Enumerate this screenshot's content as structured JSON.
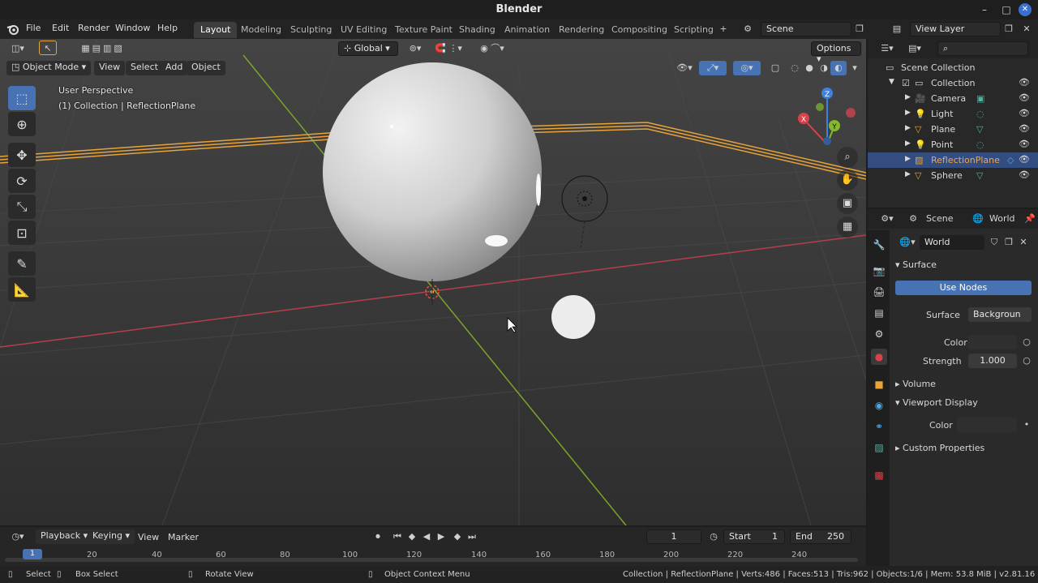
{
  "window": {
    "title": "Blender"
  },
  "menu": [
    "File",
    "Edit",
    "Render",
    "Window",
    "Help"
  ],
  "workspaces": [
    "Layout",
    "Modeling",
    "Sculpting",
    "UV Editing",
    "Texture Paint",
    "Shading",
    "Animation",
    "Rendering",
    "Compositing",
    "Scripting"
  ],
  "active_workspace": "Layout",
  "scene_field": "Scene",
  "view_layer_field": "View Layer",
  "viewport": {
    "mode": "Object Mode",
    "menus": [
      "View",
      "Select",
      "Add",
      "Object"
    ],
    "orientation": "Global",
    "options_label": "Options",
    "overlay_title": "User Perspective",
    "overlay_subtitle": "(1) Collection | ReflectionPlane",
    "gizmo_labels": {
      "x": "X",
      "y": "Y",
      "z": "Z"
    }
  },
  "outliner": {
    "root": "Scene Collection",
    "collection": "Collection",
    "items": [
      {
        "label": "Camera",
        "icon": "camera-icon"
      },
      {
        "label": "Light",
        "icon": "light-icon"
      },
      {
        "label": "Plane",
        "icon": "mesh-icon"
      },
      {
        "label": "Point",
        "icon": "light-icon"
      },
      {
        "label": "ReflectionPlane",
        "icon": "probe-icon",
        "selected": true
      },
      {
        "label": "Sphere",
        "icon": "mesh-icon"
      }
    ]
  },
  "properties": {
    "scene_label": "Scene",
    "world_label": "World",
    "world_name": "World",
    "surface_panel": "Surface",
    "use_nodes": "Use Nodes",
    "surface_label": "Surface",
    "surface_value": "Backgroun",
    "color_label": "Color",
    "strength_label": "Strength",
    "strength_value": "1.000",
    "volume_panel": "Volume",
    "viewport_display_panel": "Viewport Display",
    "vd_color_label": "Color",
    "custom_props_panel": "Custom Properties"
  },
  "timeline": {
    "menus": [
      "Playback",
      "Keying",
      "View",
      "Marker"
    ],
    "current_frame": "1",
    "start_label": "Start",
    "start_value": "1",
    "end_label": "End",
    "end_value": "250",
    "playhead": "1",
    "ticks": [
      "20",
      "40",
      "60",
      "80",
      "100",
      "120",
      "140",
      "160",
      "180",
      "200",
      "220",
      "240"
    ]
  },
  "status": {
    "select": "Select",
    "box_select": "Box Select",
    "rotate_view": "Rotate View",
    "context_menu": "Object Context Menu",
    "stats": "Collection | ReflectionPlane | Verts:486 | Faces:513 | Tris:962 | Objects:1/6 | Mem: 53.8 MiB | v2.81.16"
  },
  "colors": {
    "accent": "#4772b3",
    "selected_row": "#334d80",
    "x_axis": "#d9424a",
    "y_axis": "#86b82b",
    "z_axis": "#3d82e0",
    "plane_outline": "#e8a33a"
  }
}
